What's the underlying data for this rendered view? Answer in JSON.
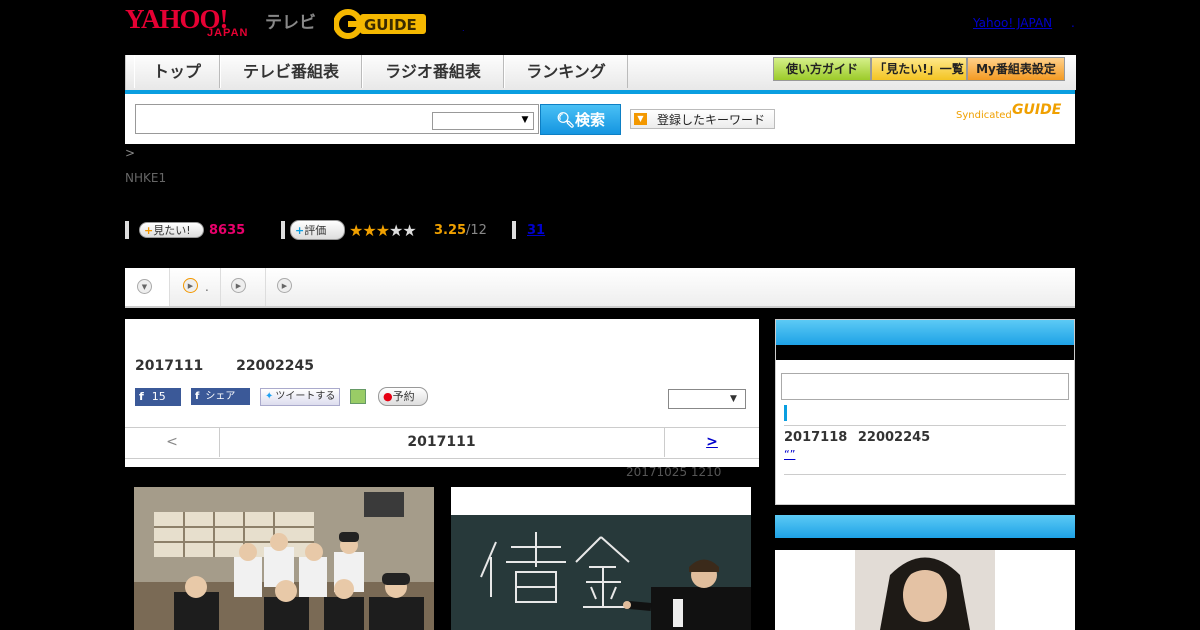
{
  "header": {
    "logo_yahoo": "YAHOO!",
    "logo_japan": "JAPAN",
    "logo_tv": "テレビ",
    "logo_gguide": "G-GUIDE",
    "yahoo_japan_link": "Yahoo! JAPAN",
    "sep_dot": "."
  },
  "nav": {
    "items": [
      "トップ",
      "テレビ番組表",
      "ラジオ番組表",
      "ランキング"
    ],
    "guide_buttons": [
      "使い方ガイド",
      "「見たい!」一覧",
      "My番組表設定"
    ]
  },
  "search": {
    "button_label": "検索",
    "keyword_button": "登録したキーワード",
    "syndicated": "Syndicated",
    "syndicated_logo": "GUIDE"
  },
  "breadcrumb": ">",
  "channel": "NHKE1",
  "stats": {
    "want_label": "見たい!",
    "want_count": "8635",
    "rate_label": "評価",
    "stars_value": 3.25,
    "score": "3.25",
    "score_of": "/12",
    "reviews": "31"
  },
  "tabs": {
    "tab2_suffix": "."
  },
  "program": {
    "title_date": "2017111",
    "title_time": "22002245",
    "fb_count": "15",
    "fb_share": "シェア",
    "tweet": "ツイートする",
    "reserve": "予約",
    "nav_prev": "<",
    "nav_date": "2017111",
    "nav_next": ">",
    "updated": "20171025  1210"
  },
  "sidebar": {
    "next_date": "2017118",
    "next_time": "22002245",
    "next_quote": "“”"
  },
  "colors": {
    "accent_blue": "#0a9ee0",
    "want_pink": "#e9006c",
    "star_orange": "#f0a000"
  }
}
